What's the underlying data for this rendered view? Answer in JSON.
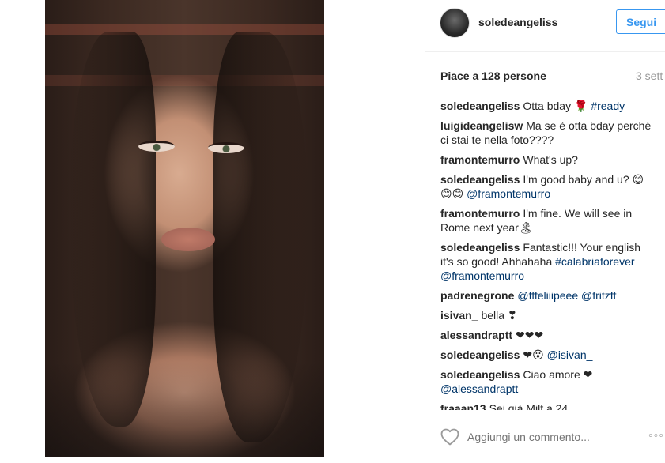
{
  "post": {
    "username": "soledeangeliss",
    "follow_label": "Segui",
    "likes": "Piace a 128 persone",
    "time": "3 sett",
    "add_comment_placeholder": "Aggiungi un commento...",
    "more": "◦◦◦"
  },
  "comments": [
    {
      "author": "soledeangeliss",
      "text": "Otta bday 🌹 ",
      "tag": "#ready"
    },
    {
      "author": "luigideangelisw",
      "text": "Ma se è otta bday perché ci stai te nella foto????",
      "tag": ""
    },
    {
      "author": "framontemurro",
      "text": "What's up?",
      "tag": ""
    },
    {
      "author": "soledeangeliss",
      "text": "I'm good baby and u? 😊😊😊 ",
      "tag": "@framontemurro"
    },
    {
      "author": "framontemurro",
      "text": "I'm fine. We will see in Rome next year🏝",
      "tag": ""
    },
    {
      "author": "soledeangeliss",
      "text": "Fantastic!!! Your english it's so good! Ahhahaha ",
      "tag": "#calabriaforever @framontemurro"
    },
    {
      "author": "padrenegrone",
      "text": "",
      "tag": "@fffeliiipeee @fritzff"
    },
    {
      "author": "isivan_",
      "text": "bella ❣",
      "tag": ""
    },
    {
      "author": "alessandraptt",
      "text": "❤❤❤",
      "tag": ""
    },
    {
      "author": "soledeangeliss",
      "text": "❤😮 ",
      "tag": "@isivan_"
    },
    {
      "author": "soledeangeliss",
      "text": "Ciao amore ❤ ",
      "tag": "@alessandraptt"
    },
    {
      "author": "fraaan13",
      "text": "Sei già Milf a 24",
      "tag": ""
    }
  ]
}
